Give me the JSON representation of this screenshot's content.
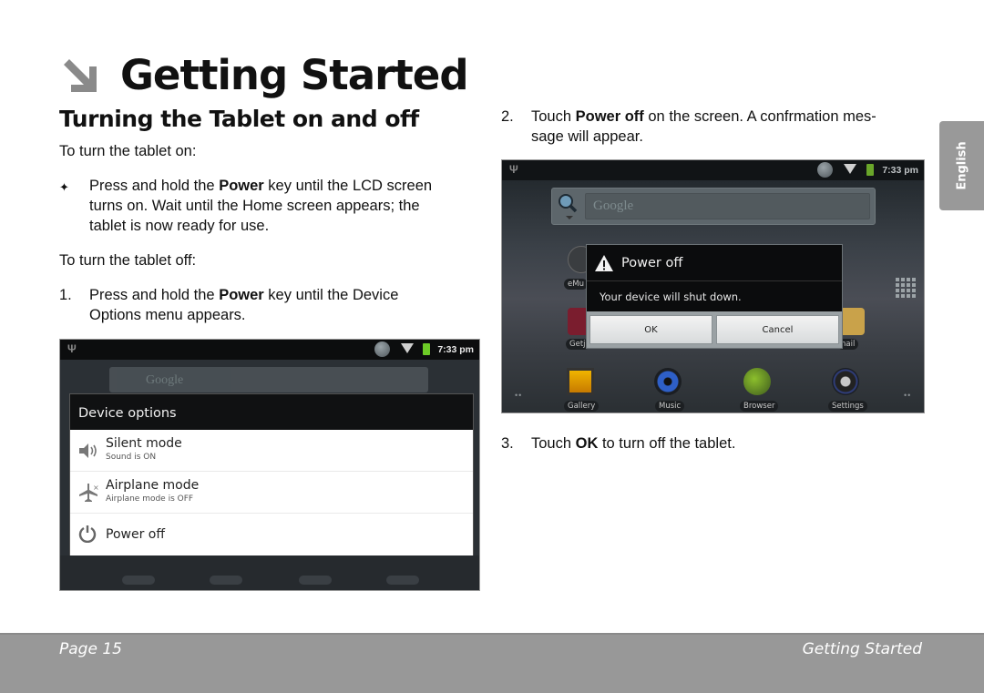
{
  "header": {
    "chapter_icon": "arrow-down-right-icon",
    "chapter_title": "Getting Started",
    "section_title": "Turning the Tablet on and off"
  },
  "body": {
    "intro_on": "To turn the tablet on:",
    "bullet_on": {
      "marker": "✦",
      "before": "Press and hold the ",
      "bold": "Power",
      "after_line1": " key until the LCD screen",
      "line2": "turns on. Wait until the Home screen appears; the",
      "line3": "tablet is now ready for use."
    },
    "intro_off": "To turn the tablet off:",
    "steps": [
      {
        "number": "1.",
        "before": "Press and hold the ",
        "bold": "Power",
        "after_line1": " key until the Device",
        "line2": "Options menu appears."
      },
      {
        "number": "2.",
        "before": "Touch ",
        "bold": "Power off",
        "after_line1": " on the screen. A confrmation mes-",
        "line2": "sage will appear."
      },
      {
        "number": "3.",
        "before": "Touch ",
        "bold": "OK",
        "after_line1": " to turn off the tablet."
      }
    ]
  },
  "screenshot_device_options": {
    "status_time": "7:33 pm",
    "icons": [
      "usb-icon",
      "sync-icon",
      "wifi-icon",
      "battery-icon"
    ],
    "search_placeholder": "Google",
    "dialog_title": "Device options",
    "options": [
      {
        "icon": "speaker-icon",
        "title": "Silent mode",
        "subtitle": "Sound is ON"
      },
      {
        "icon": "airplane-icon",
        "title": "Airplane mode",
        "subtitle": "Airplane mode is OFF"
      },
      {
        "icon": "power-icon",
        "title": "Power off"
      }
    ]
  },
  "screenshot_power_off": {
    "status_time": "7:33 pm",
    "search_placeholder": "Google",
    "dialog_title": "Power off",
    "dialog_message": "Your device will shut down.",
    "ok_label": "OK",
    "cancel_label": "Cancel",
    "apps": [
      {
        "label": "eMu",
        "icon": "emusic-icon"
      },
      {
        "label": "Getj",
        "icon": "getjar-icon"
      },
      {
        "label": "nail",
        "icon": "email-icon"
      }
    ],
    "dock": [
      {
        "label": "Gallery",
        "icon": "gallery-icon"
      },
      {
        "label": "Music",
        "icon": "music-icon"
      },
      {
        "label": "Browser",
        "icon": "browser-icon"
      },
      {
        "label": "Settings",
        "icon": "settings-icon"
      }
    ],
    "page_dots": "••"
  },
  "side_tab": {
    "label": "English"
  },
  "footer": {
    "page_label": "Page 15",
    "section_label": "Getting Started"
  },
  "colors": {
    "footer_bg": "#989898",
    "tab_bg": "#999999",
    "battery": "#6dcb27"
  }
}
